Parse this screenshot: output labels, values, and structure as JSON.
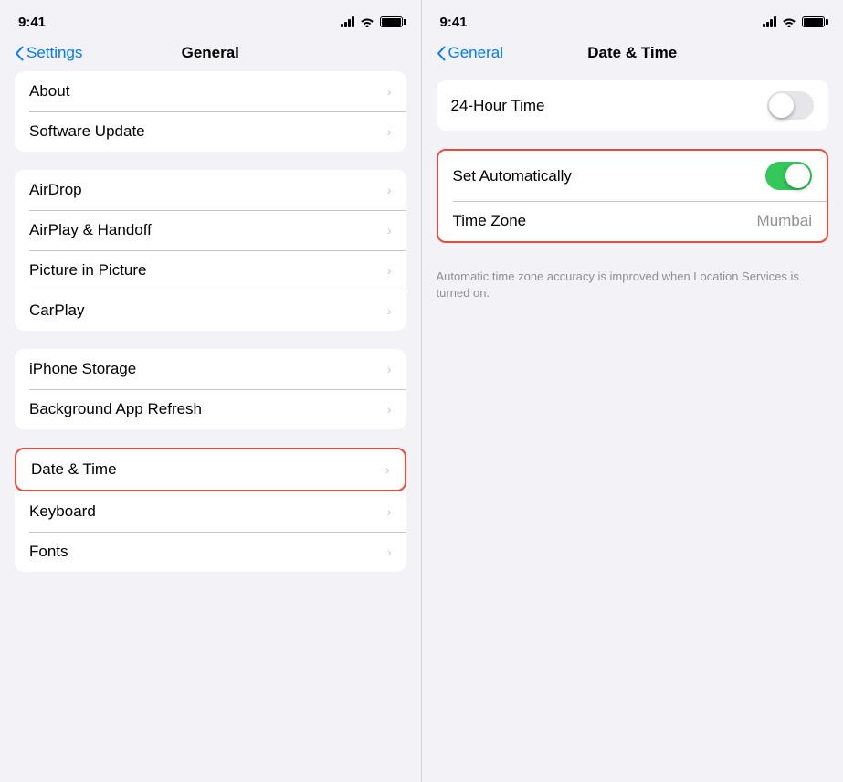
{
  "left_panel": {
    "status_time": "9:41",
    "nav_back_label": "Settings",
    "nav_title": "General",
    "groups": [
      {
        "id": "group1",
        "items": [
          {
            "label": "About",
            "highlighted": false
          },
          {
            "label": "Software Update",
            "highlighted": false
          }
        ]
      },
      {
        "id": "group2",
        "items": [
          {
            "label": "AirDrop",
            "highlighted": false
          },
          {
            "label": "AirPlay & Handoff",
            "highlighted": false
          },
          {
            "label": "Picture in Picture",
            "highlighted": false
          },
          {
            "label": "CarPlay",
            "highlighted": false
          }
        ]
      },
      {
        "id": "group3",
        "items": [
          {
            "label": "iPhone Storage",
            "highlighted": false
          },
          {
            "label": "Background App Refresh",
            "highlighted": false
          }
        ]
      },
      {
        "id": "group4_single",
        "items": [
          {
            "label": "Date & Time",
            "highlighted": true
          }
        ]
      },
      {
        "id": "group5",
        "items": [
          {
            "label": "Keyboard",
            "highlighted": false
          },
          {
            "label": "Fonts",
            "highlighted": false
          }
        ]
      }
    ]
  },
  "right_panel": {
    "status_time": "9:41",
    "nav_back_label": "General",
    "nav_title": "Date & Time",
    "rows": [
      {
        "id": "row_24h",
        "label": "24-Hour Time",
        "type": "toggle",
        "toggle_on": false,
        "highlighted": false
      },
      {
        "id": "row_auto",
        "label": "Set Automatically",
        "type": "toggle",
        "toggle_on": true,
        "highlighted": true
      },
      {
        "id": "row_timezone",
        "label": "Time Zone",
        "type": "value",
        "value": "Mumbai",
        "highlighted": false
      }
    ],
    "note": "Automatic time zone accuracy is improved when Location Services is turned on."
  },
  "icons": {
    "chevron": "›",
    "back_arrow": "‹"
  }
}
